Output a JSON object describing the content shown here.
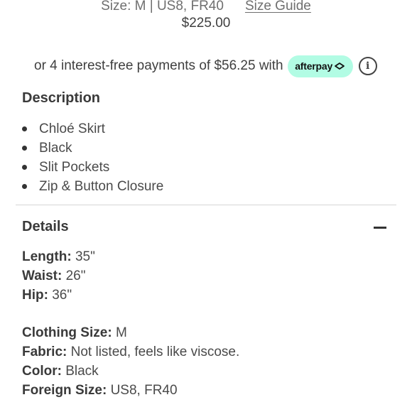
{
  "header": {
    "size_text": "Size: M | US8, FR40",
    "size_guide_label": "Size Guide",
    "price": "$225.00"
  },
  "afterpay": {
    "text": "or 4 interest-free payments of $56.25 with",
    "badge_label": "afterpay",
    "badge_color": "#b2fce4",
    "info_icon": "info-icon"
  },
  "description": {
    "title": "Description",
    "items": [
      "Chloé Skirt",
      "Black",
      "Slit Pockets",
      "Zip & Button Closure"
    ]
  },
  "details": {
    "title": "Details",
    "collapse_icon": "minus-icon",
    "specs": [
      {
        "label": "Length:",
        "value": "35\""
      },
      {
        "label": "Waist:",
        "value": "26\""
      },
      {
        "label": "Hip:",
        "value": "36\""
      },
      {
        "label": "Clothing Size:",
        "value": "M"
      },
      {
        "label": "Fabric:",
        "value": "Not listed, feels like viscose."
      },
      {
        "label": "Color:",
        "value": "Black"
      },
      {
        "label": "Foreign Size:",
        "value": "US8, FR40"
      }
    ]
  }
}
